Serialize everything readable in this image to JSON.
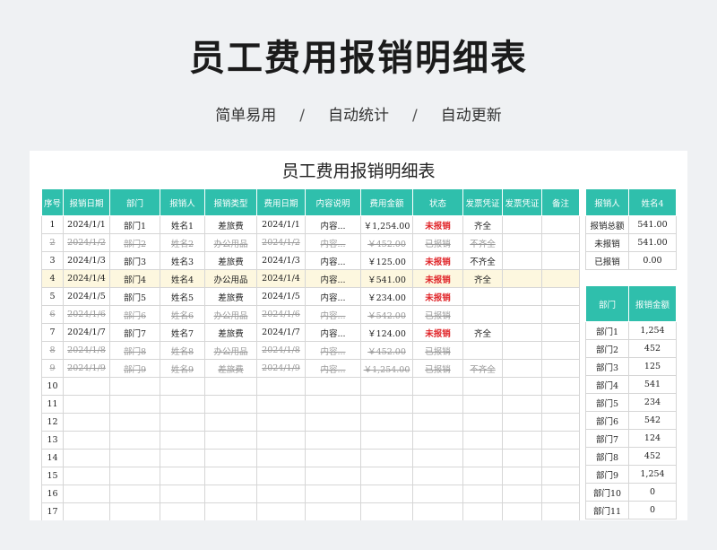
{
  "hero": {
    "title": "员工费用报销明细表",
    "tags": [
      "简单易用",
      "自动统计",
      "自动更新"
    ],
    "separator": "/"
  },
  "sheet": {
    "title": "员工费用报销明细表",
    "columns": [
      "序号",
      "报销日期",
      "部门",
      "报销人",
      "报销类型",
      "费用日期",
      "内容说明",
      "费用金额",
      "状态",
      "发票凭证",
      "发票凭证",
      "备注"
    ],
    "rows": [
      {
        "no": "1",
        "date": "2024/1/1",
        "dept": "部门1",
        "person": "姓名1",
        "type": "差旅费",
        "fdate": "2024/1/1",
        "desc": "内容...",
        "amount": "￥1,254.00",
        "status": "未报销",
        "invoice": "齐全",
        "invoice2": "",
        "note": "",
        "pale": false,
        "highlight": false
      },
      {
        "no": "2",
        "date": "2024/1/2",
        "dept": "部门2",
        "person": "姓名2",
        "type": "办公用品",
        "fdate": "2024/1/2",
        "desc": "内容...",
        "amount": "￥452.00",
        "status": "已报销",
        "invoice": "不齐全",
        "invoice2": "",
        "note": "",
        "pale": true,
        "highlight": false
      },
      {
        "no": "3",
        "date": "2024/1/3",
        "dept": "部门3",
        "person": "姓名3",
        "type": "差旅费",
        "fdate": "2024/1/3",
        "desc": "内容...",
        "amount": "￥125.00",
        "status": "未报销",
        "invoice": "不齐全",
        "invoice2": "",
        "note": "",
        "pale": false,
        "highlight": false
      },
      {
        "no": "4",
        "date": "2024/1/4",
        "dept": "部门4",
        "person": "姓名4",
        "type": "办公用品",
        "fdate": "2024/1/4",
        "desc": "内容...",
        "amount": "￥541.00",
        "status": "未报销",
        "invoice": "齐全",
        "invoice2": "",
        "note": "",
        "pale": false,
        "highlight": true
      },
      {
        "no": "5",
        "date": "2024/1/5",
        "dept": "部门5",
        "person": "姓名5",
        "type": "差旅费",
        "fdate": "2024/1/5",
        "desc": "内容...",
        "amount": "￥234.00",
        "status": "未报销",
        "invoice": "",
        "invoice2": "",
        "note": "",
        "pale": false,
        "highlight": false
      },
      {
        "no": "6",
        "date": "2024/1/6",
        "dept": "部门6",
        "person": "姓名6",
        "type": "办公用品",
        "fdate": "2024/1/6",
        "desc": "内容...",
        "amount": "￥542.00",
        "status": "已报销",
        "invoice": "",
        "invoice2": "",
        "note": "",
        "pale": true,
        "highlight": false
      },
      {
        "no": "7",
        "date": "2024/1/7",
        "dept": "部门7",
        "person": "姓名7",
        "type": "差旅费",
        "fdate": "2024/1/7",
        "desc": "内容...",
        "amount": "￥124.00",
        "status": "未报销",
        "invoice": "齐全",
        "invoice2": "",
        "note": "",
        "pale": false,
        "highlight": false
      },
      {
        "no": "8",
        "date": "2024/1/8",
        "dept": "部门8",
        "person": "姓名8",
        "type": "办公用品",
        "fdate": "2024/1/8",
        "desc": "内容...",
        "amount": "￥452.00",
        "status": "已报销",
        "invoice": "",
        "invoice2": "",
        "note": "",
        "pale": true,
        "highlight": false
      },
      {
        "no": "9",
        "date": "2024/1/9",
        "dept": "部门9",
        "person": "姓名9",
        "type": "差旅费",
        "fdate": "2024/1/9",
        "desc": "内容...",
        "amount": "￥1,254.00",
        "status": "已报销",
        "invoice": "不齐全",
        "invoice2": "",
        "note": "",
        "pale": true,
        "highlight": false
      }
    ],
    "empty_rows": [
      "10",
      "11",
      "12",
      "13",
      "14",
      "15",
      "16",
      "17"
    ]
  },
  "summary": {
    "header": [
      "报销人",
      "姓名4"
    ],
    "rows": [
      {
        "label": "报销总额",
        "value": "541.00"
      },
      {
        "label": "未报销",
        "value": "541.00"
      },
      {
        "label": "已报销",
        "value": "0.00"
      }
    ]
  },
  "dept_totals": {
    "header": [
      "部门",
      "报销金额"
    ],
    "rows": [
      {
        "dept": "部门1",
        "amount": "1,254"
      },
      {
        "dept": "部门2",
        "amount": "452"
      },
      {
        "dept": "部门3",
        "amount": "125"
      },
      {
        "dept": "部门4",
        "amount": "541"
      },
      {
        "dept": "部门5",
        "amount": "234"
      },
      {
        "dept": "部门6",
        "amount": "542"
      },
      {
        "dept": "部门7",
        "amount": "124"
      },
      {
        "dept": "部门8",
        "amount": "452"
      },
      {
        "dept": "部门9",
        "amount": "1,254"
      },
      {
        "dept": "部门10",
        "amount": "0"
      },
      {
        "dept": "部门11",
        "amount": "0"
      }
    ]
  },
  "colors": {
    "header": "#2fbfac",
    "unpaid": "#e0262a",
    "highlight": "#fdf7df"
  }
}
